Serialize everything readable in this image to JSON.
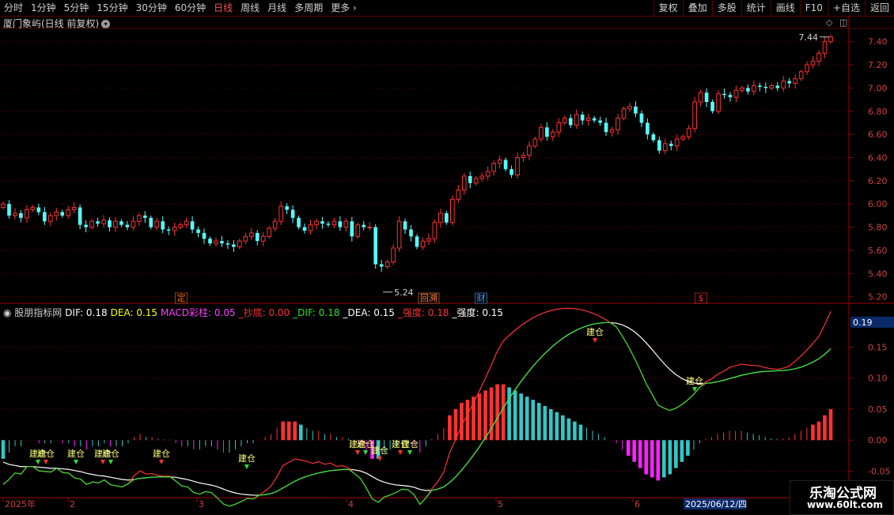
{
  "toolbar": {
    "periods": [
      "分时",
      "1分钟",
      "5分钟",
      "15分钟",
      "30分钟",
      "60分钟",
      "日线",
      "周线",
      "月线",
      "多周期",
      "更多"
    ],
    "active_period": "日线",
    "more_arrow": "chevron-right-icon",
    "right_buttons": [
      "复权",
      "叠加",
      "多股",
      "统计",
      "画线",
      "F10",
      "+自选",
      "返回"
    ]
  },
  "main": {
    "title": "厦门象屿(日线 前复权)",
    "title_icon": "chevron-down-icon",
    "price_axis": [
      "7.40",
      "7.20",
      "7.00",
      "6.80",
      "6.60",
      "6.40",
      "6.20",
      "6.00",
      "5.80",
      "5.60",
      "5.40",
      "5.20"
    ],
    "high_label": "7.44",
    "low_label": "5.24",
    "event_markers": [
      {
        "text": "定",
        "color": "#ff6a00"
      },
      {
        "text": "回溯",
        "color": "#ff8040"
      },
      {
        "text": "财",
        "color": "#4aa0ff"
      },
      {
        "text": "$",
        "color": "#ff3030"
      }
    ],
    "window_icons": [
      "diamond-icon",
      "restore-window-icon"
    ]
  },
  "indicator": {
    "name": "股朋指标网",
    "fields": [
      {
        "label": "DIF:",
        "value": "0.18",
        "color": "#ffffff"
      },
      {
        "label": "DEA:",
        "value": "0.15",
        "color": "#ffff00"
      },
      {
        "label": "MACD彩柱:",
        "value": "0.05",
        "color": "#ff40ff"
      },
      {
        "label": "_抄底:",
        "value": "0.00",
        "color": "#ff3030"
      },
      {
        "label": "_DIF:",
        "value": "0.18",
        "color": "#30e030"
      },
      {
        "label": "_DEA:",
        "value": "0.15",
        "color": "#ffffff"
      },
      {
        "label": "_强度:",
        "value": "0.18",
        "color": "#ff3030"
      },
      {
        "label": "_强度:",
        "value": "0.15",
        "color": "#ffffff"
      }
    ],
    "axis": [
      "0.15",
      "0.10",
      "0.05",
      "0.00",
      "-0.05"
    ],
    "current_value": "0.19",
    "signal_text": "建仓"
  },
  "date_axis": {
    "labels": [
      "2025年",
      "2",
      "3",
      "4",
      "5",
      "6"
    ],
    "cursor_date": "2025/06/12/四"
  },
  "watermark": {
    "line1": "乐淘公式网",
    "line2": "www.60lt.com"
  },
  "chart_data": {
    "type": "candlestick",
    "price_range": [
      5.15,
      7.5
    ],
    "high": 7.44,
    "low": 5.24,
    "closes": [
      6.0,
      5.9,
      5.92,
      5.88,
      5.95,
      5.97,
      5.93,
      5.85,
      5.9,
      5.93,
      5.9,
      5.95,
      5.97,
      5.82,
      5.8,
      5.85,
      5.83,
      5.86,
      5.8,
      5.85,
      5.82,
      5.8,
      5.85,
      5.9,
      5.88,
      5.8,
      5.85,
      5.78,
      5.77,
      5.8,
      5.82,
      5.85,
      5.78,
      5.75,
      5.7,
      5.66,
      5.68,
      5.66,
      5.65,
      5.63,
      5.68,
      5.72,
      5.75,
      5.68,
      5.72,
      5.79,
      5.85,
      5.98,
      5.95,
      5.88,
      5.8,
      5.77,
      5.82,
      5.85,
      5.83,
      5.82,
      5.85,
      5.8,
      5.85,
      5.72,
      5.82,
      5.8,
      5.8,
      5.48,
      5.46,
      5.5,
      5.62,
      5.85,
      5.78,
      5.72,
      5.63,
      5.68,
      5.7,
      5.84,
      5.92,
      5.84,
      6.04,
      6.12,
      6.24,
      6.18,
      6.22,
      6.24,
      6.28,
      6.35,
      6.38,
      6.3,
      6.25,
      6.4,
      6.42,
      6.5,
      6.56,
      6.66,
      6.58,
      6.62,
      6.7,
      6.74,
      6.68,
      6.77,
      6.72,
      6.74,
      6.72,
      6.7,
      6.62,
      6.64,
      6.74,
      6.82,
      6.84,
      6.78,
      6.7,
      6.6,
      6.55,
      6.46,
      6.52,
      6.5,
      6.56,
      6.58,
      6.65,
      6.88,
      6.96,
      6.88,
      6.8,
      6.95,
      6.94,
      6.92,
      6.98,
      7.0,
      6.97,
      7.02,
      7.01,
      7.0,
      7.02,
      7.0,
      7.06,
      7.04,
      7.08,
      7.14,
      7.2,
      7.23,
      7.3,
      7.4,
      7.44
    ],
    "indicator": {
      "ylim": [
        -0.09,
        0.2
      ],
      "macd_bars": [
        -0.03,
        -0.02,
        -0.01,
        -0.01,
        0,
        0,
        -0.005,
        -0.005,
        -0.005,
        0,
        -0.005,
        -0.005,
        -0.01,
        -0.01,
        -0.015,
        -0.01,
        -0.01,
        -0.005,
        -0.01,
        -0.01,
        -0.01,
        -0.005,
        0.005,
        0.01,
        0.005,
        0.005,
        0.002,
        0.001,
        0.001,
        -0.005,
        -0.01,
        -0.01,
        -0.015,
        -0.015,
        -0.01,
        -0.01,
        -0.015,
        -0.02,
        -0.02,
        -0.015,
        -0.01,
        -0.005,
        -0.005,
        0,
        0.005,
        0.01,
        0.02,
        0.03,
        0.03,
        0.03,
        0.025,
        0.02,
        0.015,
        0.015,
        0.01,
        0.01,
        0.005,
        0.005,
        0.002,
        -0.005,
        -0.01,
        -0.02,
        -0.03,
        -0.03,
        -0.02,
        -0.015,
        -0.01,
        -0.005,
        -0.005,
        -0.01,
        -0.02,
        -0.01,
        0.002,
        0.01,
        0.02,
        0.04,
        0.05,
        0.06,
        0.065,
        0.07,
        0.075,
        0.08,
        0.085,
        0.09,
        0.09,
        0.085,
        0.08,
        0.075,
        0.07,
        0.065,
        0.06,
        0.055,
        0.05,
        0.045,
        0.04,
        0.035,
        0.03,
        0.025,
        0.02,
        0.015,
        0.01,
        0.005,
        0,
        -0.005,
        -0.015,
        -0.025,
        -0.035,
        -0.045,
        -0.055,
        -0.06,
        -0.065,
        -0.06,
        -0.055,
        -0.045,
        -0.035,
        -0.025,
        -0.015,
        -0.005,
        0.002,
        0.005,
        0.01,
        0.012,
        0.015,
        0.015,
        0.015,
        0.012,
        0.01,
        0.008,
        0.005,
        0.003,
        0.002,
        0.003,
        0.005,
        0.01,
        0.015,
        0.02,
        0.025,
        0.03,
        0.04,
        0.05
      ],
      "signals": [
        "建仓",
        "建仓",
        "建仓",
        "建仓",
        "建仓",
        "建仓",
        "建仓",
        "建仓",
        "建仓",
        "建仓",
        "建仓",
        "建仓",
        "建仓",
        "建仓"
      ]
    }
  }
}
